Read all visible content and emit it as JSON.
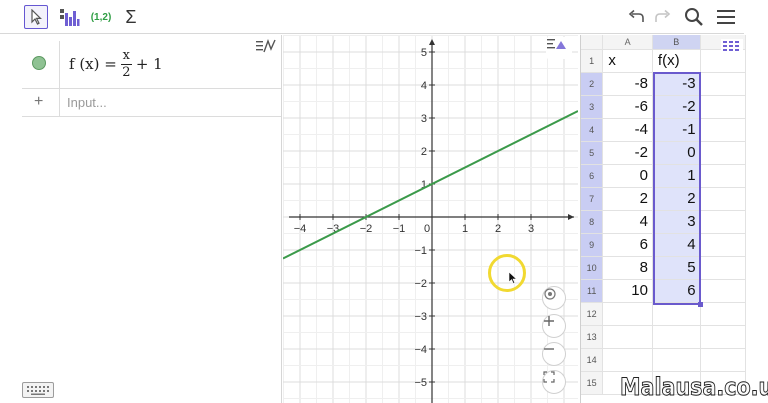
{
  "toolbar": {
    "tools": [
      {
        "id": "move",
        "icon": "arrow-cursor-icon"
      },
      {
        "id": "one-var-analysis",
        "icon": "bar-chart-icon"
      },
      {
        "id": "create-list-of-points",
        "label": "(1,2)"
      },
      {
        "id": "sum",
        "label": "Σ"
      }
    ],
    "right": [
      "undo-icon",
      "redo-icon",
      "search-icon",
      "menu-icon"
    ],
    "accent": "#6557d2"
  },
  "algebra": {
    "function_name": "f",
    "function_label": "f (x) =",
    "numerator": "x",
    "denominator": "2",
    "tail": "+ 1",
    "input_placeholder": "Input...",
    "add_symbol": "+",
    "line_color": "#3b9a4a"
  },
  "graphics": {
    "x_ticks": [
      "−4",
      "−3",
      "−2",
      "−1",
      "0",
      "1",
      "2",
      "3"
    ],
    "y_ticks": [
      "5",
      "4",
      "3",
      "2",
      "1",
      "−1",
      "−2",
      "−3",
      "−4",
      "−5"
    ],
    "xlim": [
      -4.4,
      4.2
    ],
    "ylim": [
      -5.8,
      5.8
    ],
    "function": {
      "slope": 0.5,
      "intercept": 1,
      "color": "#3b9a4a"
    }
  },
  "spreadsheet": {
    "columns": [
      "A",
      "B"
    ],
    "rows": [
      {
        "n": "1",
        "a": "x",
        "b": "f(x)"
      },
      {
        "n": "2",
        "a": "-8",
        "b": "-3"
      },
      {
        "n": "3",
        "a": "-6",
        "b": "-2"
      },
      {
        "n": "4",
        "a": "-4",
        "b": "-1"
      },
      {
        "n": "5",
        "a": "-2",
        "b": "0"
      },
      {
        "n": "6",
        "a": "0",
        "b": "1"
      },
      {
        "n": "7",
        "a": "2",
        "b": "2"
      },
      {
        "n": "8",
        "a": "4",
        "b": "3"
      },
      {
        "n": "9",
        "a": "6",
        "b": "4"
      },
      {
        "n": "10",
        "a": "8",
        "b": "5"
      },
      {
        "n": "11",
        "a": "10",
        "b": "6"
      },
      {
        "n": "12",
        "a": "",
        "b": ""
      },
      {
        "n": "13",
        "a": "",
        "b": ""
      },
      {
        "n": "14",
        "a": "",
        "b": ""
      },
      {
        "n": "15",
        "a": "",
        "b": ""
      }
    ],
    "selection_color": "#6a5acd"
  },
  "watermark": "Malausa.co.uk"
}
